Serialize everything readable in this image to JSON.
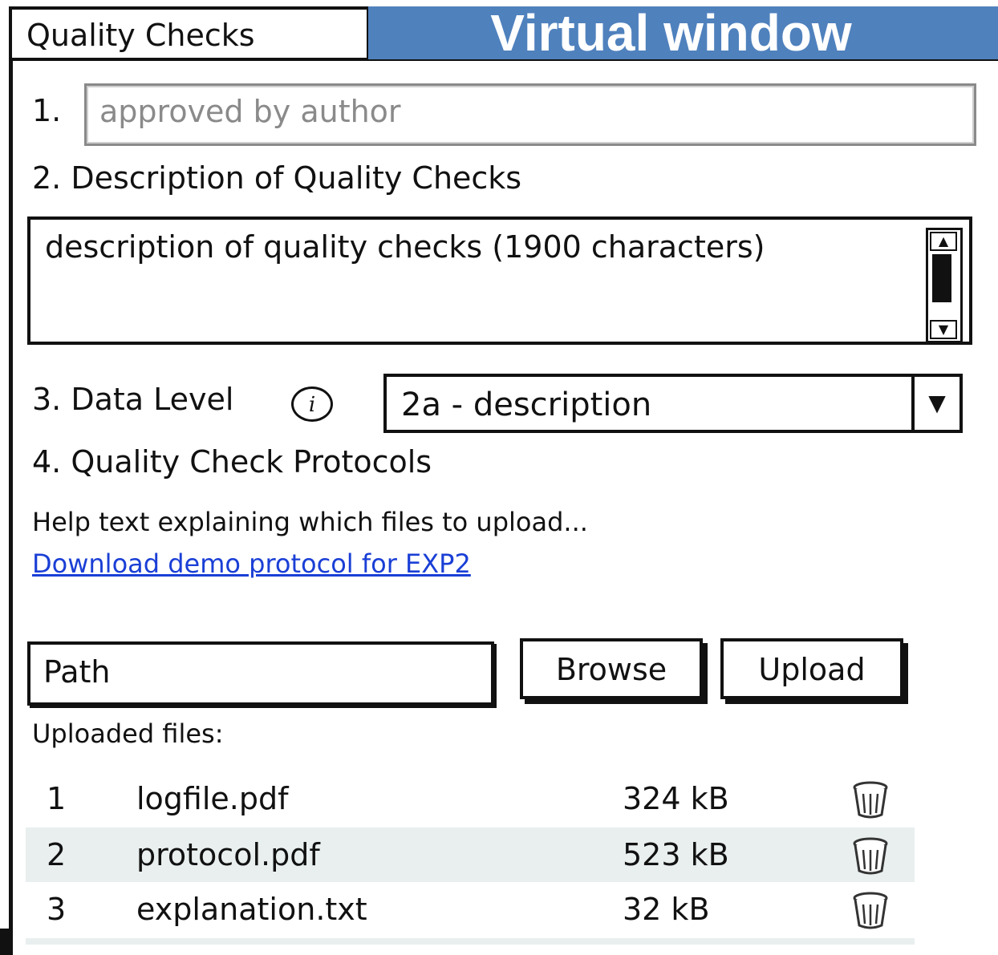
{
  "window": {
    "title": "Quality Checks",
    "banner": "Virtual window"
  },
  "field1": {
    "number": "1.",
    "placeholder": "approved by author"
  },
  "field2": {
    "label": "2. Description of Quality Checks",
    "text": "description of quality checks (1900 characters)"
  },
  "field3": {
    "label": "3. Data Level",
    "info_icon": "info-icon",
    "selected": "2a - description"
  },
  "field4": {
    "label": "4. Quality Check Protocols",
    "help": "Help text explaining which files to upload...",
    "link": "Download demo protocol for EXP2"
  },
  "upload": {
    "path_value": "Path",
    "browse_label": "Browse",
    "upload_label": "Upload"
  },
  "files": {
    "label": "Uploaded files:",
    "rows": [
      {
        "num": "1",
        "name": "logfile.pdf",
        "size": "324 kB"
      },
      {
        "num": "2",
        "name": "protocol.pdf",
        "size": "523 kB"
      },
      {
        "num": "3",
        "name": "explanation.txt",
        "size": "32 kB"
      }
    ]
  },
  "colors": {
    "banner": "#4f81bd",
    "link": "#1a3fd6",
    "row_alt": "#e9efef"
  }
}
